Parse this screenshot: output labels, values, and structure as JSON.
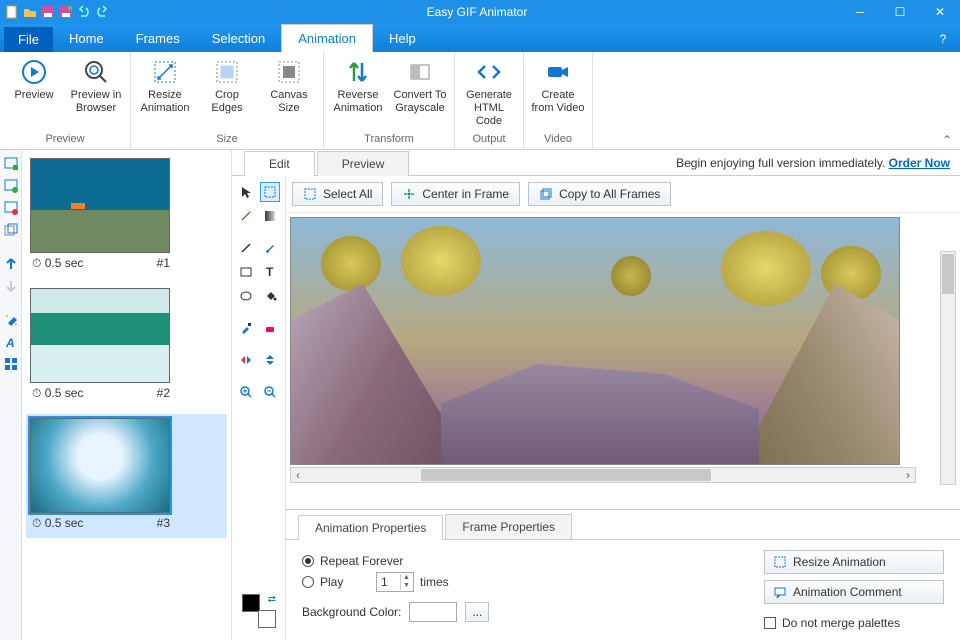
{
  "app": {
    "title": "Easy GIF Animator"
  },
  "tabs": {
    "file": "File",
    "home": "Home",
    "frames": "Frames",
    "selection": "Selection",
    "animation": "Animation",
    "help": "Help"
  },
  "ribbon": {
    "preview": {
      "title": "Preview",
      "preview": "Preview",
      "browser": "Preview in\nBrowser"
    },
    "size": {
      "title": "Size",
      "resize": "Resize\nAnimation",
      "crop": "Crop\nEdges",
      "canvas": "Canvas\nSize"
    },
    "transform": {
      "title": "Transform",
      "reverse": "Reverse\nAnimation",
      "grayscale": "Convert To\nGrayscale"
    },
    "output": {
      "title": "Output",
      "html": "Generate\nHTML Code"
    },
    "video": {
      "title": "Video",
      "create": "Create\nfrom Video"
    }
  },
  "promo": {
    "text": "Begin enjoying full version immediately. ",
    "link": "Order Now"
  },
  "editor": {
    "tabs": {
      "edit": "Edit",
      "preview": "Preview"
    },
    "toolbar": {
      "selectAll": "Select All",
      "center": "Center in Frame",
      "copyAll": "Copy to All Frames"
    }
  },
  "frames": [
    {
      "duration": "0.5 sec",
      "index": "#1"
    },
    {
      "duration": "0.5 sec",
      "index": "#2"
    },
    {
      "duration": "0.5 sec",
      "index": "#3"
    }
  ],
  "props": {
    "tabs": {
      "anim": "Animation Properties",
      "frame": "Frame Properties"
    },
    "repeatForever": "Repeat Forever",
    "play": "Play",
    "playValue": "1",
    "times": "times",
    "bgcolor": "Background Color:",
    "resizeBtn": "Resize Animation",
    "commentBtn": "Animation Comment",
    "noMerge": "Do not merge palettes"
  },
  "clock": "⏱"
}
